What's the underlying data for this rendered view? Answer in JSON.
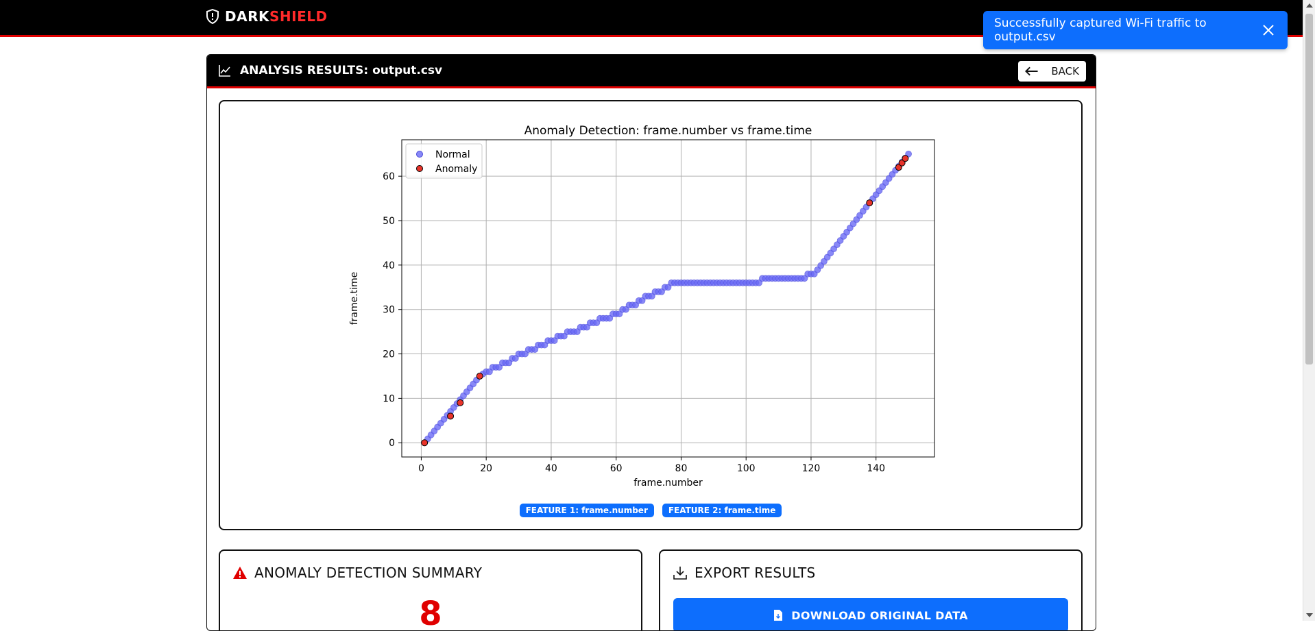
{
  "navbar": {
    "brand_part1": "DARK",
    "brand_part2": "SHIELD"
  },
  "toast": {
    "message": "Successfully captured Wi-Fi traffic to output.csv",
    "close_icon": "close-icon"
  },
  "panel": {
    "title": "ANALYSIS RESULTS: output.csv",
    "back_label": "BACK",
    "icon": "line-chart-icon"
  },
  "badges": {
    "feature1": "FEATURE 1: frame.number",
    "feature2": "FEATURE 2: frame.time"
  },
  "summary": {
    "title": "ANOMALY DETECTION SUMMARY",
    "count": "8",
    "icon": "warning-icon"
  },
  "export": {
    "title": "EXPORT RESULTS",
    "download_label": "DOWNLOAD ORIGINAL DATA",
    "icon": "download-icon",
    "button_icon": "file-download-icon"
  },
  "colors": {
    "accent_red": "#e00000",
    "primary_blue": "#0d6efd",
    "normal_point": "#6a6af5",
    "anomaly_point": "#e8332a"
  },
  "chart_data": {
    "type": "scatter",
    "title": "Anomaly Detection: frame.number vs frame.time",
    "xlabel": "frame.number",
    "ylabel": "frame.time",
    "xlim": [
      -6,
      158
    ],
    "ylim": [
      -3.2,
      68.2
    ],
    "xticks": [
      0,
      20,
      40,
      60,
      80,
      100,
      120,
      140
    ],
    "yticks": [
      0,
      10,
      20,
      30,
      40,
      50,
      60
    ],
    "grid": true,
    "legend_position": "top-left",
    "legend": [
      "Normal",
      "Anomaly"
    ],
    "normal_curve": {
      "note": "Normal points at every integer frame.number from 1 to 150 following these breakpoints (frame.number, frame.time); frame.time rounded to whole units where the plot shows steps",
      "breakpoints": [
        [
          1,
          0
        ],
        [
          18,
          15
        ],
        [
          20,
          16
        ],
        [
          40,
          23
        ],
        [
          60,
          29
        ],
        [
          78,
          36
        ],
        [
          104,
          36
        ],
        [
          105,
          37
        ],
        [
          118,
          37
        ],
        [
          119,
          38
        ],
        [
          121,
          38
        ],
        [
          138,
          54
        ],
        [
          150,
          65
        ]
      ],
      "rounded_ranges": [
        [
          20,
          104
        ]
      ]
    },
    "anomalies": [
      {
        "x": 1,
        "y": 0
      },
      {
        "x": 9,
        "y": 6
      },
      {
        "x": 12,
        "y": 9
      },
      {
        "x": 18,
        "y": 15
      },
      {
        "x": 138,
        "y": 54
      },
      {
        "x": 147,
        "y": 62
      },
      {
        "x": 148,
        "y": 63
      },
      {
        "x": 149,
        "y": 64
      }
    ]
  }
}
